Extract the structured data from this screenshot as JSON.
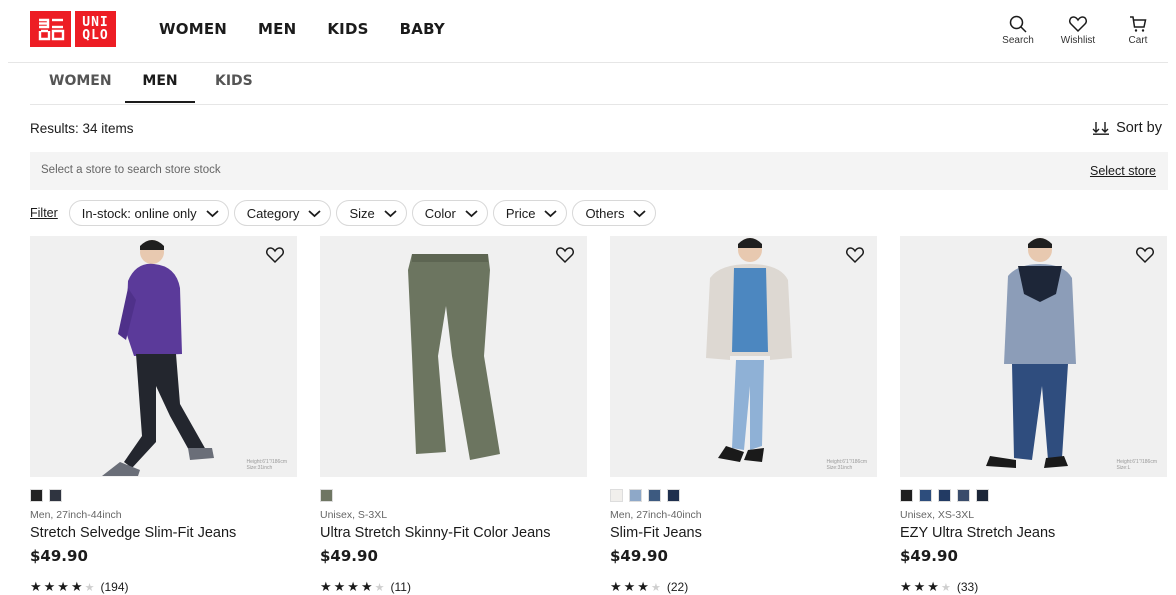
{
  "brand": {
    "logo_left": "ユニ\nクロ",
    "logo_right_top": "UNI",
    "logo_right_bottom": "QLO",
    "logo_color": "#ed1d24"
  },
  "main_nav": [
    "WOMEN",
    "MEN",
    "KIDS",
    "BABY"
  ],
  "header_icons": [
    {
      "label": "Search",
      "icon": "search-icon"
    },
    {
      "label": "Wishlist",
      "icon": "heart-icon"
    },
    {
      "label": "Cart",
      "icon": "cart-icon"
    }
  ],
  "sub_tabs": {
    "women": "WOMEN",
    "men": "MEN",
    "kids": "KIDS",
    "active": "MEN"
  },
  "results": {
    "text": "Results: 34 items",
    "sort_label": "Sort by"
  },
  "store": {
    "hint": "Select a store to search store stock",
    "select_label": "Select store"
  },
  "filters": {
    "link": "Filter",
    "chips": [
      "In-stock: online only",
      "Category",
      "Size",
      "Color",
      "Price",
      "Others"
    ]
  },
  "products": [
    {
      "meta": "Men, 27inch-44inch",
      "name": "Stretch Selvedge Slim-Fit Jeans",
      "price": "$49.90",
      "stars": "★★★★",
      "empty_stars": "★",
      "count": "(194)",
      "swatches": [
        "#222222",
        "#2f3440"
      ],
      "note": "Height:6'1\"/186cm\nSize:31inch"
    },
    {
      "meta": "Unisex, S-3XL",
      "name": "Ultra Stretch Skinny-Fit Color Jeans",
      "price": "$49.90",
      "stars": "★★★★",
      "empty_stars": "★",
      "count": "(11)",
      "swatches": [
        "#6f7663"
      ],
      "note": ""
    },
    {
      "meta": "Men, 27inch-40inch",
      "name": "Slim-Fit Jeans",
      "price": "$49.90",
      "stars": "★★★",
      "empty_stars": "★",
      "count": "(22)",
      "swatches": [
        "#f1efec",
        "#8ea8c8",
        "#3d5a80",
        "#1e2f4d"
      ],
      "note": "Height:6'1\"/186cm\nSize:31inch"
    },
    {
      "meta": "Unisex, XS-3XL",
      "name": "EZY Ultra Stretch Jeans",
      "price": "$49.90",
      "stars": "★★★",
      "empty_stars": "★",
      "count": "(33)",
      "swatches": [
        "#1f1f1f",
        "#2d4d7c",
        "#223a63",
        "#3a4c6b",
        "#1c2638"
      ],
      "note": "Height:6'1\"/186cm\nSize:L"
    }
  ]
}
